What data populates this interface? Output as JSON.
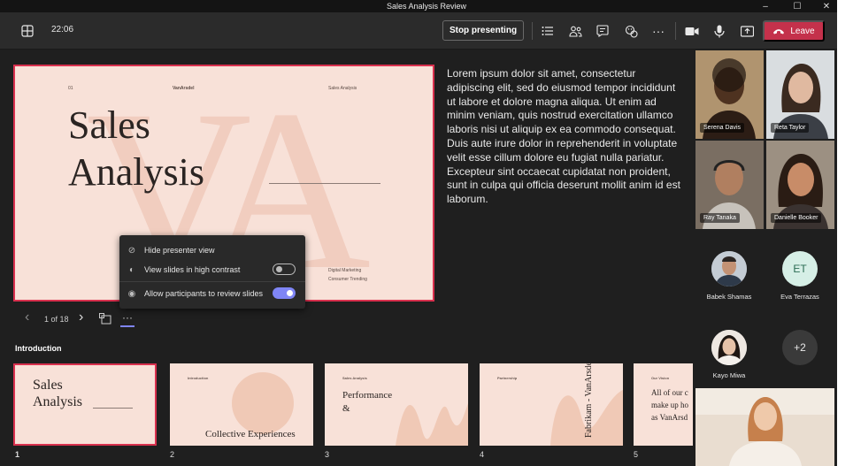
{
  "window": {
    "title": "Sales Analysis Review",
    "minimize": "–",
    "maximize": "☐",
    "close": "✕"
  },
  "toolbar": {
    "time": "22:06",
    "stop_presenting": "Stop presenting",
    "leave": "Leave",
    "icons": [
      "grid-icon",
      "list-icon",
      "people-icon",
      "chat-icon",
      "react-icon",
      "more-icon",
      "camera-icon",
      "mic-icon",
      "share-icon",
      "phone-icon"
    ]
  },
  "slide": {
    "page_label": "01",
    "brand": "VanArsdel",
    "header_right": "Sales Analysis",
    "title_line1": "Sales",
    "title_line2": "Analysis",
    "footer1": "Digital Marketing",
    "footer2": "Consumer Trending",
    "watermark": "VA"
  },
  "notes": "Lorem ipsum dolor sit amet, consectetur adipiscing elit, sed do eiusmod tempor incididunt ut labore et dolore magna aliqua. Ut enim ad minim veniam, quis nostrud exercitation ullamco laboris nisi ut aliquip ex ea commodo consequat. Duis aute irure dolor in reprehenderit in voluptate velit esse cillum dolore eu fugiat nulla pariatur. Excepteur sint occaecat cupidatat non proident, sunt in culpa qui officia deserunt mollit anim id est laborum.",
  "menu": {
    "hide_presenter": "Hide presenter view",
    "high_contrast": "View slides in high contrast",
    "allow_review": "Allow participants to review slides",
    "high_contrast_on": false,
    "allow_review_on": true
  },
  "nav": {
    "page": "1 of 18",
    "prev": "‹",
    "next": "›",
    "more": "···"
  },
  "section": "Introduction",
  "thumbs": [
    {
      "num": "1",
      "title1": "Sales",
      "title2": "Analysis"
    },
    {
      "num": "2",
      "heading": "Introduction",
      "title": "Collective Experiences"
    },
    {
      "num": "3",
      "heading": "Sales Analysis",
      "title1": "Performance",
      "title2": "&"
    },
    {
      "num": "4",
      "heading": "Partnership",
      "title": "Fabrikam - VanArsdel"
    },
    {
      "num": "5",
      "heading": "Our Vision",
      "l1": "All of our c",
      "l2": "make up ho",
      "l3": "as VanArsd"
    }
  ],
  "participants": {
    "video": [
      {
        "name": "Serena Davis",
        "bg": "#a88a6a",
        "skin": "#5a3a26"
      },
      {
        "name": "Reta Taylor",
        "bg": "#7a7f86",
        "skin": "#d9b39a"
      },
      {
        "name": "Ray Tanaka",
        "bg": "#6e6258",
        "skin": "#b88a6c"
      },
      {
        "name": "Danielle Booker",
        "bg": "#8a7f72",
        "skin": "#c28a68"
      }
    ],
    "avatars": [
      {
        "name": "Babek Shamas",
        "initials": "",
        "bg": "#b0b8c2"
      },
      {
        "name": "Eva Terrazas",
        "initials": "ET",
        "bg": "#d6efe6",
        "fg": "#2a6b52"
      },
      {
        "name": "Kayo Miwa",
        "initials": "",
        "bg": "#e8e2dc"
      }
    ],
    "overflow": "+2"
  }
}
